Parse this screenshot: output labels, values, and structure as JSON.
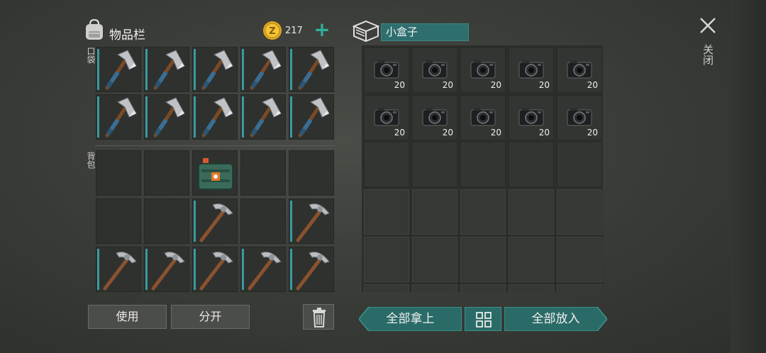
{
  "inventory": {
    "title": "物品栏",
    "coins": "217",
    "pocket_label": "口袋",
    "backpack_label": "背包"
  },
  "container": {
    "title": "小盒子",
    "camera_count": "20"
  },
  "buttons": {
    "use": "使用",
    "split": "分开",
    "take_all": "全部拿上",
    "put_all": "全部放入",
    "close": "关闭"
  },
  "colors": {
    "accent_teal": "#2fb09a",
    "slot_marker": "#3a9aa0",
    "coin_gold": "#e0a81e"
  },
  "icons": {
    "backpack": "backpack-icon",
    "coin": "coin-icon",
    "plus": "plus-icon",
    "box": "box-icon",
    "trash": "trash-icon",
    "grid": "grid-toggle-icon",
    "close": "close-icon",
    "hatchet": "hatchet-icon",
    "pickaxe": "pickaxe-icon",
    "crate": "supply-crate-icon",
    "camera": "camera-icon"
  }
}
